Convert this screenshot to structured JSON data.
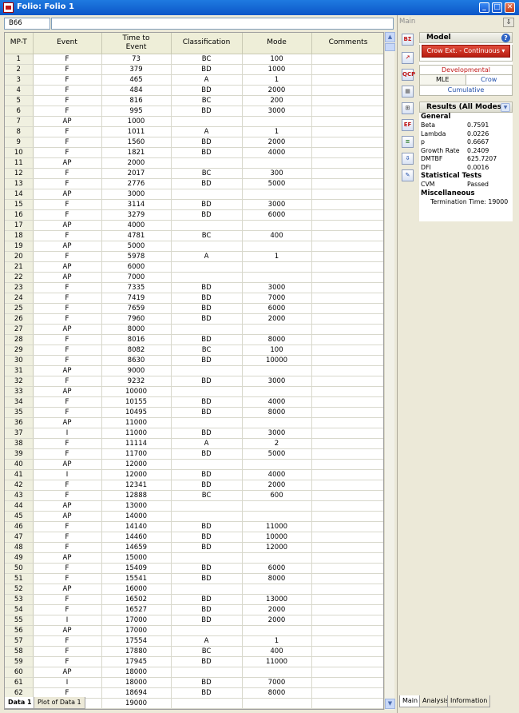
{
  "window": {
    "title": "Folio: Folio 1"
  },
  "cell_ref": "B66",
  "columns": [
    "MP-T",
    "Event",
    "Time to Event",
    "Classification",
    "Mode",
    "Comments"
  ],
  "rows": [
    [
      "1",
      "F",
      "73",
      "BC",
      "100",
      ""
    ],
    [
      "2",
      "F",
      "379",
      "BD",
      "1000",
      ""
    ],
    [
      "3",
      "F",
      "465",
      "A",
      "1",
      ""
    ],
    [
      "4",
      "F",
      "484",
      "BD",
      "2000",
      ""
    ],
    [
      "5",
      "F",
      "816",
      "BC",
      "200",
      ""
    ],
    [
      "6",
      "F",
      "995",
      "BD",
      "3000",
      ""
    ],
    [
      "7",
      "AP",
      "1000",
      "",
      "",
      ""
    ],
    [
      "8",
      "F",
      "1011",
      "A",
      "1",
      ""
    ],
    [
      "9",
      "F",
      "1560",
      "BD",
      "2000",
      ""
    ],
    [
      "10",
      "F",
      "1821",
      "BD",
      "4000",
      ""
    ],
    [
      "11",
      "AP",
      "2000",
      "",
      "",
      ""
    ],
    [
      "12",
      "F",
      "2017",
      "BC",
      "300",
      ""
    ],
    [
      "13",
      "F",
      "2776",
      "BD",
      "5000",
      ""
    ],
    [
      "14",
      "AP",
      "3000",
      "",
      "",
      ""
    ],
    [
      "15",
      "F",
      "3114",
      "BD",
      "3000",
      ""
    ],
    [
      "16",
      "F",
      "3279",
      "BD",
      "6000",
      ""
    ],
    [
      "17",
      "AP",
      "4000",
      "",
      "",
      ""
    ],
    [
      "18",
      "F",
      "4781",
      "BC",
      "400",
      ""
    ],
    [
      "19",
      "AP",
      "5000",
      "",
      "",
      ""
    ],
    [
      "20",
      "F",
      "5978",
      "A",
      "1",
      ""
    ],
    [
      "21",
      "AP",
      "6000",
      "",
      "",
      ""
    ],
    [
      "22",
      "AP",
      "7000",
      "",
      "",
      ""
    ],
    [
      "23",
      "F",
      "7335",
      "BD",
      "3000",
      ""
    ],
    [
      "24",
      "F",
      "7419",
      "BD",
      "7000",
      ""
    ],
    [
      "25",
      "F",
      "7659",
      "BD",
      "6000",
      ""
    ],
    [
      "26",
      "F",
      "7960",
      "BD",
      "2000",
      ""
    ],
    [
      "27",
      "AP",
      "8000",
      "",
      "",
      ""
    ],
    [
      "28",
      "F",
      "8016",
      "BD",
      "8000",
      ""
    ],
    [
      "29",
      "F",
      "8082",
      "BC",
      "100",
      ""
    ],
    [
      "30",
      "F",
      "8630",
      "BD",
      "10000",
      ""
    ],
    [
      "31",
      "AP",
      "9000",
      "",
      "",
      ""
    ],
    [
      "32",
      "F",
      "9232",
      "BD",
      "3000",
      ""
    ],
    [
      "33",
      "AP",
      "10000",
      "",
      "",
      ""
    ],
    [
      "34",
      "F",
      "10155",
      "BD",
      "4000",
      ""
    ],
    [
      "35",
      "F",
      "10495",
      "BD",
      "8000",
      ""
    ],
    [
      "36",
      "AP",
      "11000",
      "",
      "",
      ""
    ],
    [
      "37",
      "I",
      "11000",
      "BD",
      "3000",
      ""
    ],
    [
      "38",
      "F",
      "11114",
      "A",
      "2",
      ""
    ],
    [
      "39",
      "F",
      "11700",
      "BD",
      "5000",
      ""
    ],
    [
      "40",
      "AP",
      "12000",
      "",
      "",
      ""
    ],
    [
      "41",
      "I",
      "12000",
      "BD",
      "4000",
      ""
    ],
    [
      "42",
      "F",
      "12341",
      "BD",
      "2000",
      ""
    ],
    [
      "43",
      "F",
      "12888",
      "BC",
      "600",
      ""
    ],
    [
      "44",
      "AP",
      "13000",
      "",
      "",
      ""
    ],
    [
      "45",
      "AP",
      "14000",
      "",
      "",
      ""
    ],
    [
      "46",
      "F",
      "14140",
      "BD",
      "11000",
      ""
    ],
    [
      "47",
      "F",
      "14460",
      "BD",
      "10000",
      ""
    ],
    [
      "48",
      "F",
      "14659",
      "BD",
      "12000",
      ""
    ],
    [
      "49",
      "AP",
      "15000",
      "",
      "",
      ""
    ],
    [
      "50",
      "F",
      "15409",
      "BD",
      "6000",
      ""
    ],
    [
      "51",
      "F",
      "15541",
      "BD",
      "8000",
      ""
    ],
    [
      "52",
      "AP",
      "16000",
      "",
      "",
      ""
    ],
    [
      "53",
      "F",
      "16502",
      "BD",
      "13000",
      ""
    ],
    [
      "54",
      "F",
      "16527",
      "BD",
      "2000",
      ""
    ],
    [
      "55",
      "I",
      "17000",
      "BD",
      "2000",
      ""
    ],
    [
      "56",
      "AP",
      "17000",
      "",
      "",
      ""
    ],
    [
      "57",
      "F",
      "17554",
      "A",
      "1",
      ""
    ],
    [
      "58",
      "F",
      "17880",
      "BC",
      "400",
      ""
    ],
    [
      "59",
      "F",
      "17945",
      "BD",
      "11000",
      ""
    ],
    [
      "60",
      "AP",
      "18000",
      "",
      "",
      ""
    ],
    [
      "61",
      "I",
      "18000",
      "BD",
      "7000",
      ""
    ],
    [
      "62",
      "F",
      "18694",
      "BD",
      "8000",
      ""
    ],
    [
      "63",
      "PH",
      "19000",
      "",
      "",
      ""
    ]
  ],
  "sheet_tabs": [
    "Data 1",
    "Plot of Data 1"
  ],
  "right_panel": {
    "header": "Main",
    "pin_icon": "pin-icon",
    "tool_icons": [
      "ΒΣ",
      "↗",
      "QCP",
      "▦",
      "⊞",
      "EF",
      "≡",
      "⇩",
      "✎"
    ],
    "model": {
      "title": "Model",
      "button": "Crow Ext. - Continuous",
      "option1": "Developmental",
      "option2a": "MLE",
      "option2b": "Crow",
      "option3": "Cumulative"
    },
    "results": {
      "title": "Results (All Modes)",
      "general_label": "General",
      "general": [
        {
          "k": "Beta",
          "v": "0.7591"
        },
        {
          "k": "Lambda",
          "v": "0.0226"
        },
        {
          "k": "p",
          "v": "0.6667"
        },
        {
          "k": "Growth Rate",
          "v": "0.2409"
        },
        {
          "k": "DMTBF",
          "v": "625.7207"
        },
        {
          "k": "DFI",
          "v": "0.0016"
        }
      ],
      "tests_label": "Statistical Tests",
      "tests": [
        {
          "k": "CVM",
          "v": "Passed"
        }
      ],
      "misc_label": "Miscellaneous",
      "misc": "Termination Time: 19000"
    },
    "tabs": [
      "Main",
      "Analysis",
      "Information"
    ]
  },
  "colors": {
    "title_bar": "#0b56c8",
    "model_button": "#c8281a",
    "link_blue": "#1e4ca8",
    "developmental_red": "#c01818"
  }
}
